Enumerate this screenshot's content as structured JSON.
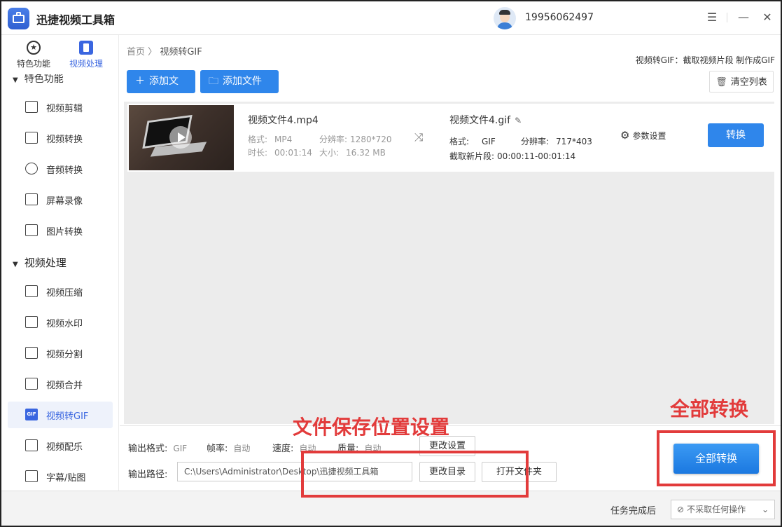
{
  "app": {
    "title": "迅捷视频工具箱",
    "user_phone": "19956062497",
    "icons": {
      "menu": "menu-icon",
      "minimize": "minimize-icon",
      "close": "close-icon"
    }
  },
  "sidebar": {
    "tabs": [
      {
        "label": "特色功能",
        "icon": "star-icon",
        "active": false
      },
      {
        "label": "视频处理",
        "icon": "film-icon",
        "active": true
      }
    ],
    "cut_group_label": "特色功能",
    "group1_items": [
      {
        "label": "视频剪辑",
        "icon": "crop-icon"
      },
      {
        "label": "视频转换",
        "icon": "video-convert-icon"
      },
      {
        "label": "音频转换",
        "icon": "audio-icon"
      },
      {
        "label": "屏幕录像",
        "icon": "screen-record-icon"
      },
      {
        "label": "图片转换",
        "icon": "image-icon"
      }
    ],
    "group2_title": "视频处理",
    "group2_items": [
      {
        "label": "视频压缩",
        "icon": "compress-icon"
      },
      {
        "label": "视频水印",
        "icon": "watermark-icon"
      },
      {
        "label": "视频分割",
        "icon": "split-icon"
      },
      {
        "label": "视频合并",
        "icon": "merge-icon"
      },
      {
        "label": "视频转GIF",
        "icon": "gif-icon",
        "active": true
      },
      {
        "label": "视频配乐",
        "icon": "music-icon"
      },
      {
        "label": "字幕/贴图",
        "icon": "subtitle-icon"
      }
    ]
  },
  "main": {
    "breadcrumb_home": "首页",
    "breadcrumb_sep": "〉",
    "breadcrumb_current": "视频转GIF",
    "header_desc": "视频转GIF：截取视频片段 制作成GIF",
    "add_file_label": "添加文件",
    "add_folder_label": "添加文件夹",
    "clear_list_label": "清空列表",
    "file": {
      "source_name": "视频文件4.mp4",
      "format_label": "格式:",
      "format": "MP4",
      "resolution_label": "分辨率:",
      "resolution": "1280*720",
      "duration_label": "时长:",
      "duration": "00:01:14",
      "size_label": "大小:",
      "size": "16.32 MB",
      "output_name": "视频文件4.gif",
      "out_format_label": "格式:",
      "out_format": "GIF",
      "out_resolution_label": "分辨率:",
      "out_resolution": "717*403",
      "clip_label": "截取新片段:",
      "clip_range": "00:00:11-00:01:14",
      "params_label": "参数设置",
      "convert_label": "转换"
    },
    "output": {
      "format_label": "输出格式:",
      "format": "GIF",
      "fps_label": "帧率:",
      "fps": "自动",
      "speed_label": "速度:",
      "speed": "自动",
      "quality_label": "质量:",
      "quality": "自动",
      "change_settings_label": "更改设置",
      "path_label": "输出路径:",
      "path": "C:\\Users\\Administrator\\Desktop\\迅捷视频工具箱",
      "change_dir_label": "更改目录",
      "open_folder_label": "打开文件夹",
      "convert_all_label": "全部转换"
    }
  },
  "status": {
    "after_task_label": "任务完成后",
    "after_task_value": "不采取任何操作"
  },
  "annotations": {
    "save_location": "文件保存位置设置",
    "convert_all": "全部转换",
    "color": "#e23b3b"
  }
}
